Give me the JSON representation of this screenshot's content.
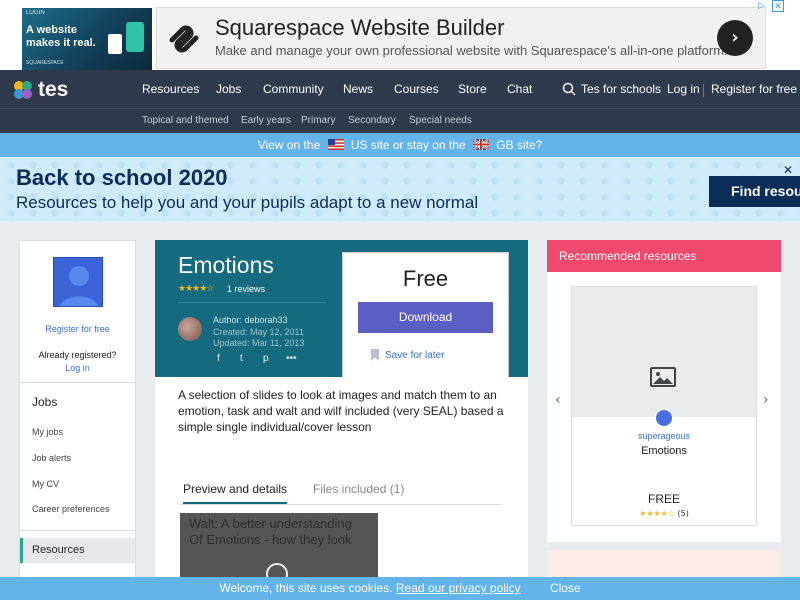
{
  "ad": {
    "thumb_top": "LOGIN",
    "thumb_text": "A website makes it real.",
    "thumb_brand": "SQUARESPACE",
    "title": "Squarespace Website Builder",
    "subtitle": "Make and manage your own professional website with Squarespace's all-in-one platform.",
    "go": "›",
    "close": "✕"
  },
  "nav": {
    "logo": "tes",
    "items": [
      "Resources",
      "Jobs",
      "Community",
      "News",
      "Courses",
      "Store",
      "Chat"
    ],
    "schools": "Tes for schools",
    "login": "Log in",
    "register": "Register for free",
    "sub_items": [
      "Topical and themed",
      "Early years",
      "Primary",
      "Secondary",
      "Special needs"
    ]
  },
  "site_bar": {
    "view_on": "View on the",
    "us": "US site or stay on the",
    "gb": "GB site?"
  },
  "banner": {
    "title": "Back to school 2020",
    "subtitle": "Resources to help you and your pupils adapt to a new normal",
    "button": "Find resources",
    "close": "✕"
  },
  "sidebar": {
    "register": "Register for free",
    "already": "Already registered?",
    "login": "Log in",
    "jobs_heading": "Jobs",
    "links": [
      "My jobs",
      "Job alerts",
      "My CV",
      "Career preferences"
    ],
    "resources": "Resources"
  },
  "resource": {
    "title": "Emotions",
    "stars": "★★★★☆",
    "reviews": "1 reviews",
    "author": "Author: deborah33",
    "created": "Created: May 12, 2011",
    "updated": "Updated: Mar 11, 2013",
    "share": [
      "f",
      "t",
      "p",
      "•••"
    ],
    "price": "Free",
    "download": "Download",
    "save": "Save for later",
    "description": "A selection of slides to look at images and match them to an emotion, task and walt and wilf included (very SEAL) based a simple single individual/cover lesson",
    "tabs": [
      "Preview and details",
      "Files included (1)"
    ],
    "preview_text": "Walt: A better understanding Of Emotions - how they look"
  },
  "recommended": {
    "heading": "Recommended resources",
    "user": "superageous",
    "title": "Emotions",
    "price": "FREE",
    "stars": "★★★★☆",
    "count": "(5)",
    "prev": "‹",
    "next": "›"
  },
  "cookie": {
    "text": "Welcome, this site uses cookies.",
    "link": "Read our privacy policy",
    "close": "Close"
  },
  "colors": {
    "nav": "#2f3a4d",
    "hero": "#146b80",
    "accent_pink": "#ef4a6e",
    "download": "#5b5fc4",
    "info_bar": "#63b4ea"
  }
}
